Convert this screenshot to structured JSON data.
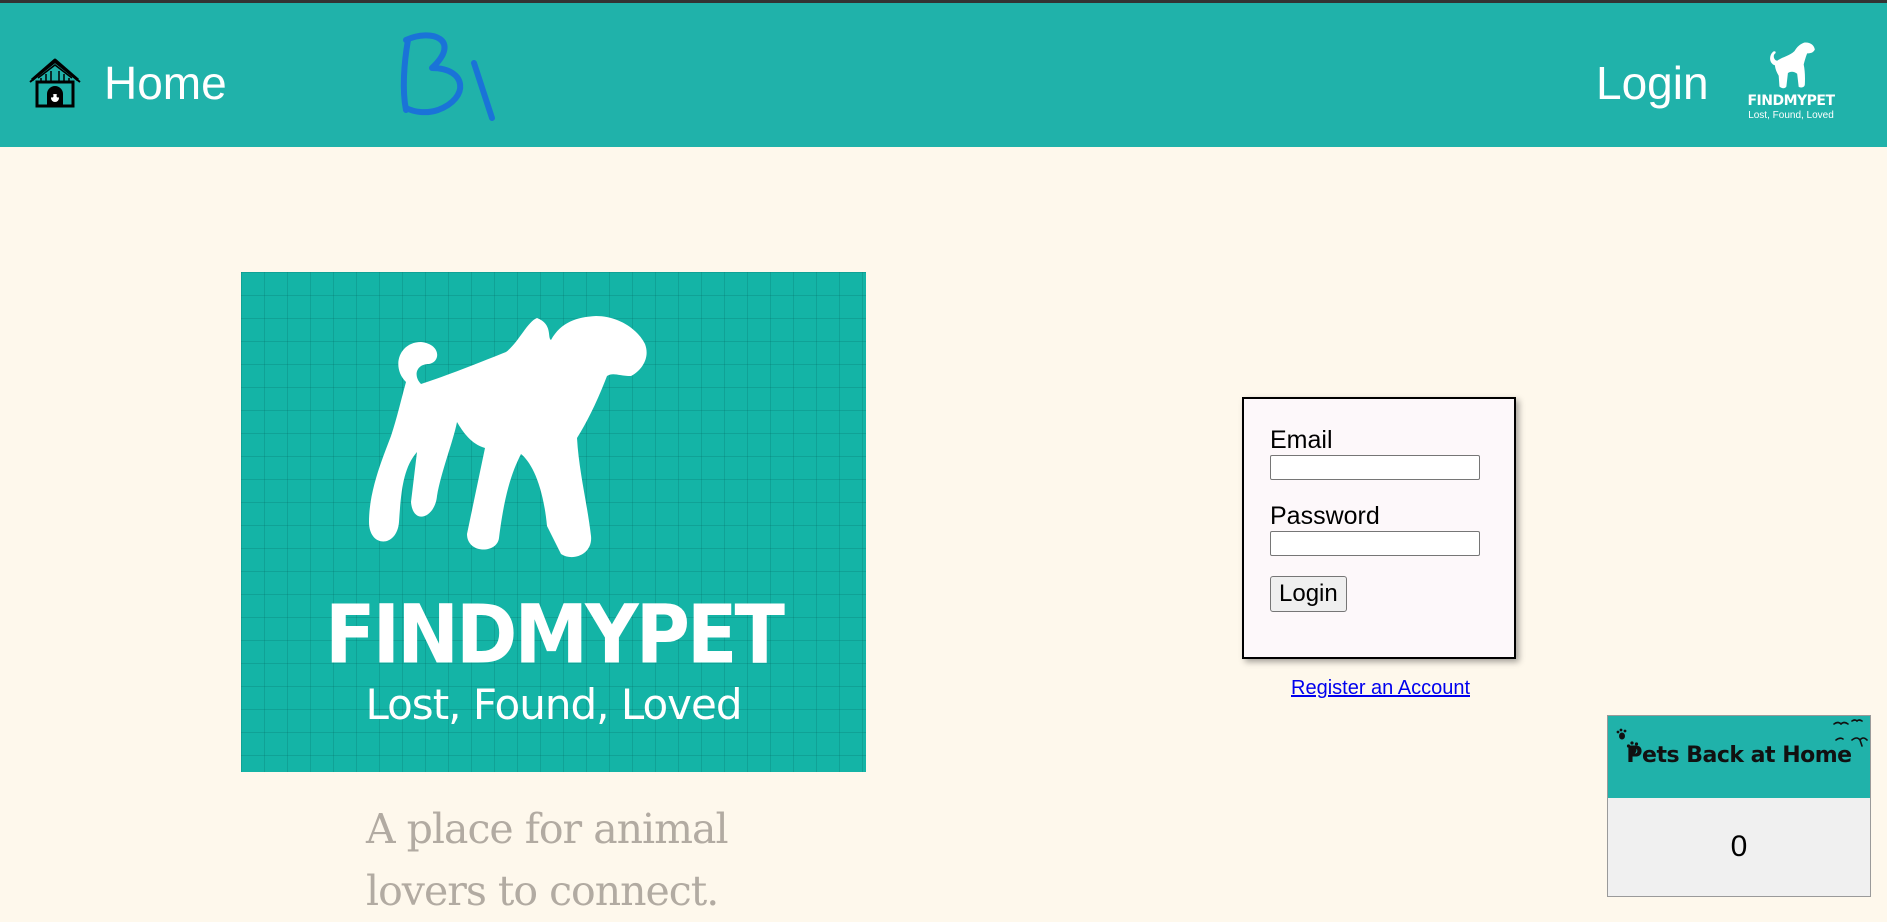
{
  "nav": {
    "home_label": "Home",
    "login_label": "Login",
    "logo": {
      "name": "FINDMYPET",
      "tagline": "Lost, Found, Loved"
    }
  },
  "hero": {
    "name": "FINDMYPET",
    "tagline": "Lost, Found, Loved",
    "description": "A place for animal lovers to connect."
  },
  "login_form": {
    "email_label": "Email",
    "email_value": "",
    "password_label": "Password",
    "password_value": "",
    "submit_label": "Login",
    "register_link": "Register an Account"
  },
  "counter": {
    "title": "Pets Back at Home",
    "value": "0"
  },
  "colors": {
    "nav_background": "#20b2aa",
    "page_background": "#fef8ec",
    "hero_background": "#14b4a6",
    "tagline_text": "#b2aba2",
    "link": "#0000ee",
    "scribble": "#1a73d8"
  },
  "icons": {
    "home": "doghouse-icon",
    "logo_dog": "dog-silhouette-icon",
    "counter_paws": "paw-prints-icon",
    "counter_birds": "birds-icon"
  }
}
